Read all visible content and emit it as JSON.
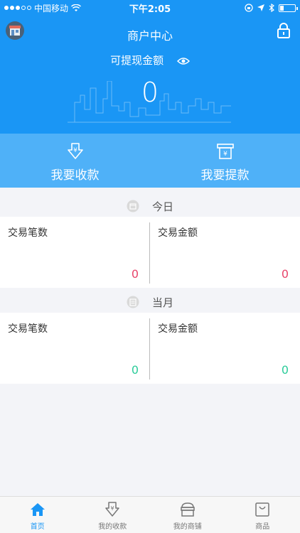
{
  "status_bar": {
    "carrier": "中国移动",
    "time": "下午2:05",
    "battery_level": 0.25
  },
  "header": {
    "title": "商户中心",
    "balance_label": "可提现金额",
    "balance_value": "0"
  },
  "actions": [
    {
      "label": "我要收款",
      "icon": "receive-yuan-icon"
    },
    {
      "label": "我要提款",
      "icon": "withdraw-yuan-icon"
    }
  ],
  "today": {
    "heading": "今日",
    "count_label": "交易笔数",
    "count_value": "0",
    "amount_label": "交易金额",
    "amount_value": "0"
  },
  "month": {
    "heading": "当月",
    "count_label": "交易笔数",
    "count_value": "0",
    "amount_label": "交易金额",
    "amount_value": "0"
  },
  "tabs": [
    {
      "label": "首页",
      "icon": "home-icon",
      "active": true
    },
    {
      "label": "我的收款",
      "icon": "receive-icon",
      "active": false
    },
    {
      "label": "我的商铺",
      "icon": "store-icon",
      "active": false
    },
    {
      "label": "商品",
      "icon": "bag-icon",
      "active": false
    }
  ],
  "colors": {
    "primary": "#1a96f5",
    "action_bar": "#4fb1f8",
    "value_today": "#e8456b",
    "value_month": "#2ccc9a"
  }
}
